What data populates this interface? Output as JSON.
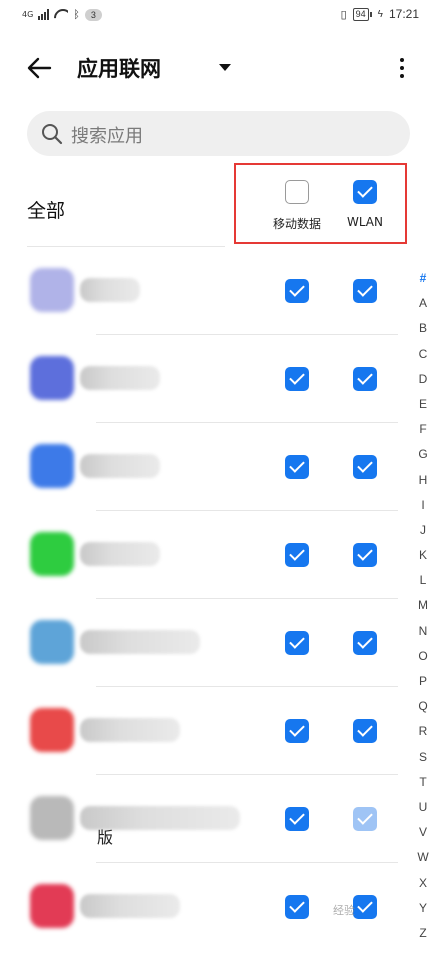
{
  "status_bar": {
    "network": "4G",
    "notification_count": "3",
    "battery": "94",
    "time": "17:21"
  },
  "header": {
    "title": "应用联网"
  },
  "search": {
    "placeholder": "搜索应用"
  },
  "all_row": {
    "label": "全部",
    "mobile_data_label": "移动数据",
    "wlan_label": "WLAN",
    "mobile_data_checked": false,
    "wlan_checked": true
  },
  "apps": [
    {
      "icon_color": "#b0b3e8",
      "name": "",
      "mobile_data": true,
      "wlan": true
    },
    {
      "icon_color": "#5d6fdc",
      "name": "",
      "mobile_data": true,
      "wlan": true
    },
    {
      "icon_color": "#3d7ae8",
      "name": "",
      "mobile_data": true,
      "wlan": true
    },
    {
      "icon_color": "#2ecc40",
      "name": "",
      "mobile_data": true,
      "wlan": true
    },
    {
      "icon_color": "#5ea4d8",
      "name": "",
      "mobile_data": true,
      "wlan": true
    },
    {
      "icon_color": "#e84a4a",
      "name": "",
      "mobile_data": true,
      "wlan": true
    },
    {
      "icon_color": "#b9b9b9",
      "name": "版",
      "mobile_data": true,
      "wlan": true,
      "wlan_faded": true
    },
    {
      "icon_color": "#e23b55",
      "name": "",
      "mobile_data": true,
      "wlan": true
    }
  ],
  "alphabet_index": [
    "#",
    "A",
    "B",
    "C",
    "D",
    "E",
    "F",
    "G",
    "H",
    "I",
    "J",
    "K",
    "L",
    "M",
    "N",
    "O",
    "P",
    "Q",
    "R",
    "S",
    "T",
    "U",
    "V",
    "W",
    "X",
    "Y",
    "Z"
  ],
  "watermark": "经验",
  "colors": {
    "accent": "#1677ef",
    "highlight_box": "#e53935"
  }
}
